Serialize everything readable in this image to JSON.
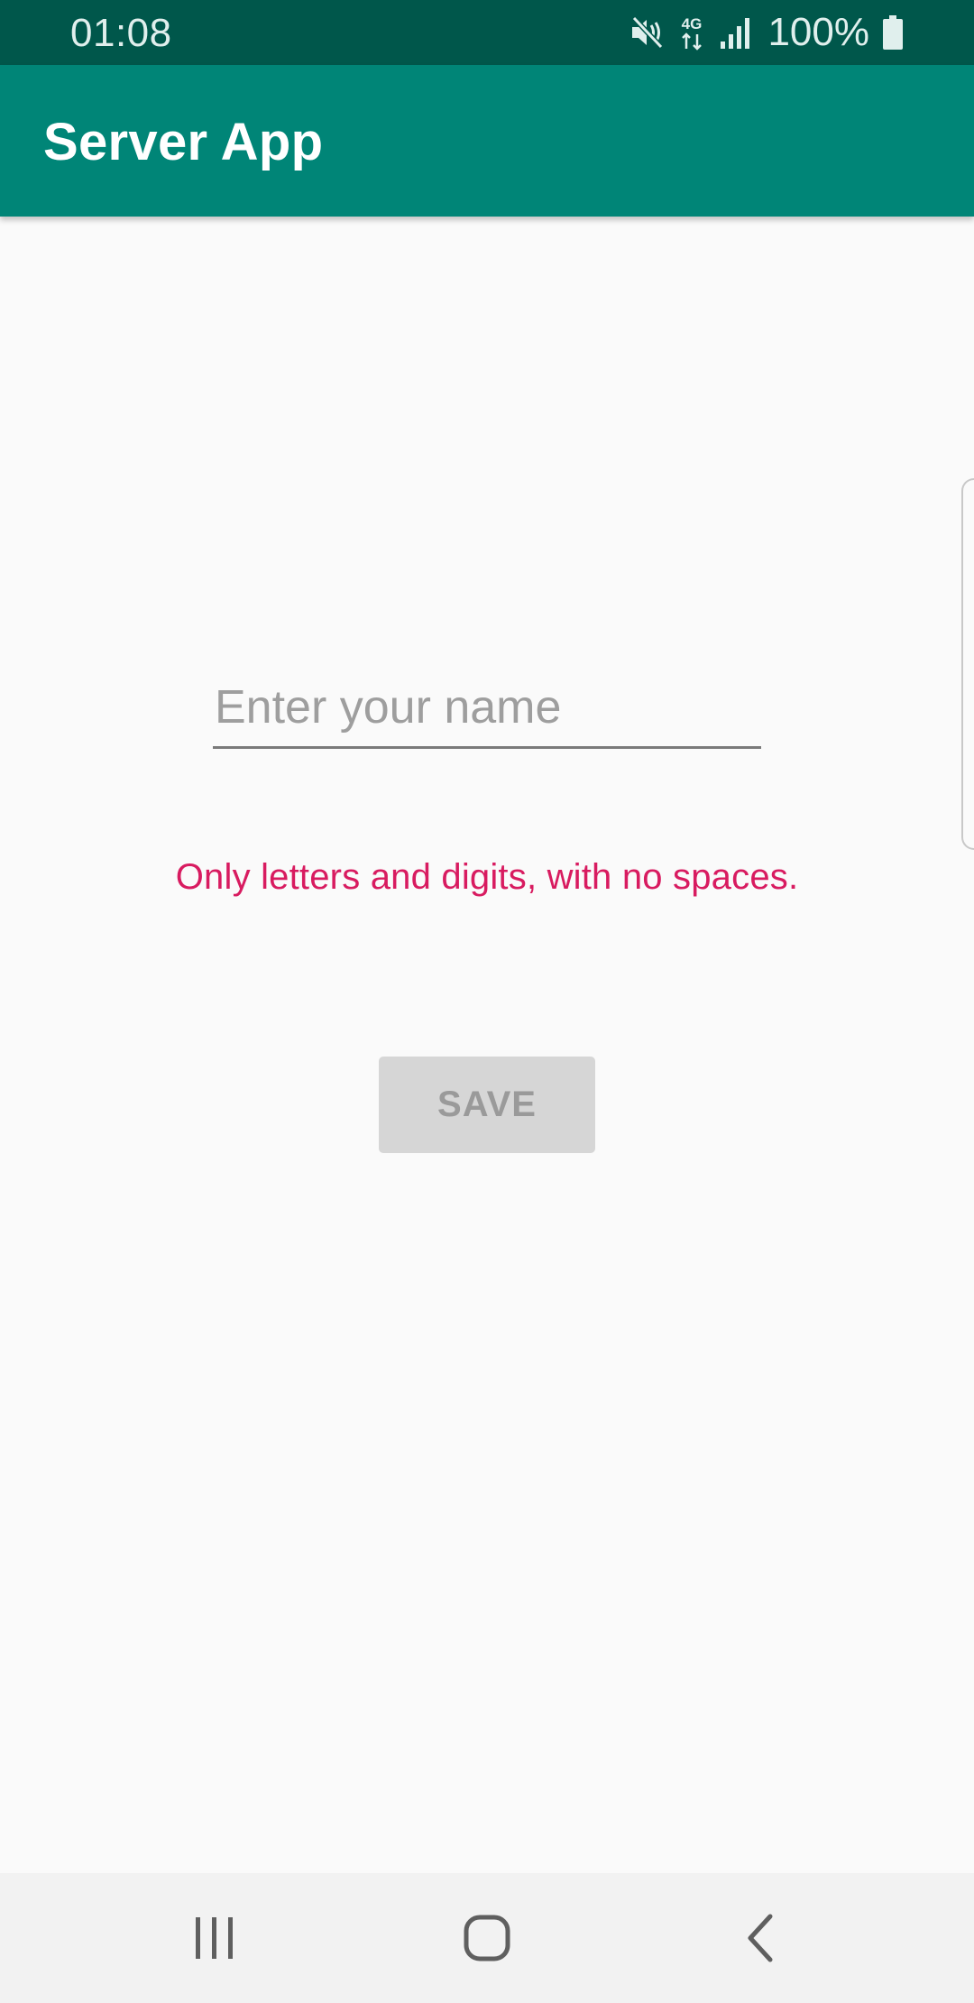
{
  "status_bar": {
    "time": "01:08",
    "battery_percent": "100%",
    "network_type": "4G",
    "icons": [
      "mute-icon",
      "network-4g-icon",
      "signal-icon",
      "battery-icon"
    ]
  },
  "app_bar": {
    "title": "Server App"
  },
  "form": {
    "name_value": "",
    "name_placeholder": "Enter your name",
    "hint": "Only letters and digits, with no spaces.",
    "save_label": "SAVE"
  },
  "nav_bar": {
    "buttons": [
      "recent-apps",
      "home",
      "back"
    ]
  },
  "colors": {
    "status_bar": "#00574b",
    "app_bar": "#008577",
    "hint": "#d81b60",
    "button_disabled": "#d6d6d6",
    "background": "#fafafa"
  }
}
